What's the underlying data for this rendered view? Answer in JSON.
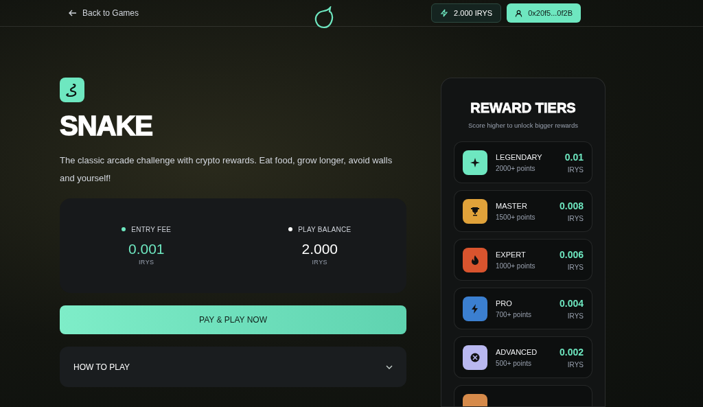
{
  "header": {
    "back_link": "Back to Games",
    "balance": "2.000 IRYS",
    "wallet": "0x20f5...0f2B"
  },
  "game": {
    "title": "SNAKE",
    "description": "The classic arcade challenge with crypto rewards. Eat food, grow longer, avoid walls and yourself!"
  },
  "stats": [
    {
      "label": "ENTRY FEE",
      "value": "0.001",
      "unit": "IRYS",
      "color": "#6ee7c0"
    },
    {
      "label": "PLAY BALANCE",
      "value": "2.000",
      "unit": "IRYS",
      "color": "#ffffff"
    }
  ],
  "play_button": "PAY & PLAY NOW",
  "how_to_play": {
    "label": "HOW TO PLAY",
    "expanded": false
  },
  "reward_tiers": {
    "title": "REWARD TIERS",
    "subtitle": "Score higher to unlock bigger rewards",
    "tiers": [
      {
        "kind": "star",
        "name": "LEGENDARY",
        "points": "2000+ points",
        "reward": "0.01",
        "unit": "IRYS",
        "color": "#6ee7c0"
      },
      {
        "kind": "trophy",
        "name": "MASTER",
        "points": "1500+ points",
        "reward": "0.008",
        "unit": "IRYS",
        "color": "#e0a23a"
      },
      {
        "kind": "flame",
        "name": "EXPERT",
        "points": "1000+ points",
        "reward": "0.006",
        "unit": "IRYS",
        "color": "#d9542e"
      },
      {
        "kind": "bolt",
        "name": "PRO",
        "points": "700+ points",
        "reward": "0.004",
        "unit": "IRYS",
        "color": "#3b7fd0"
      },
      {
        "kind": "target",
        "name": "ADVANCED",
        "points": "500+ points",
        "reward": "0.002",
        "unit": "IRYS",
        "color": "#b9b8f0"
      },
      {
        "kind": "blank",
        "color": "#d68a4a"
      }
    ]
  }
}
